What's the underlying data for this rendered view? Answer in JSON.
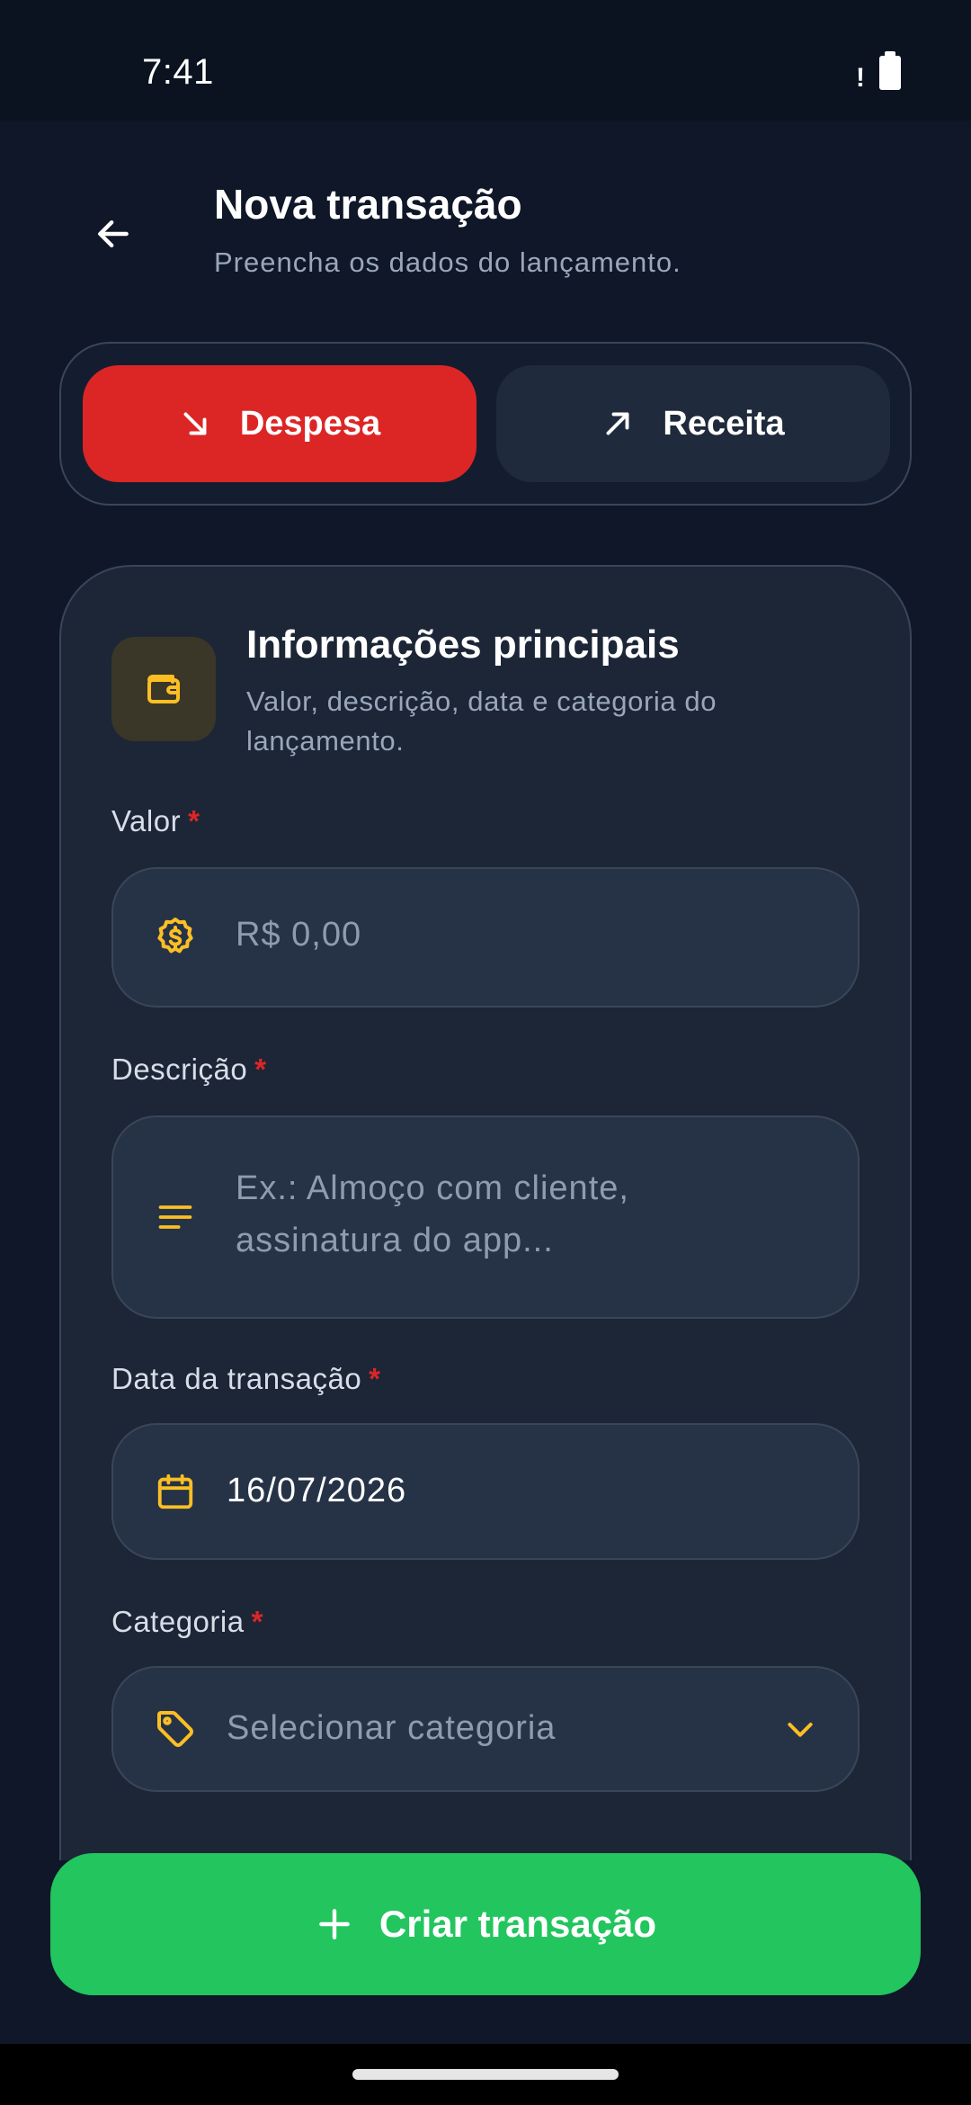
{
  "status_bar": {
    "time": "7:41",
    "alert": "!"
  },
  "header": {
    "title": "Nova transação",
    "subtitle": "Preencha os dados do lançamento."
  },
  "type_toggle": {
    "expense_label": "Despesa",
    "income_label": "Receita",
    "selected": "Despesa"
  },
  "card": {
    "title": "Informações principais",
    "subtitle": "Valor, descrição, data e categoria do lançamento."
  },
  "form": {
    "amount": {
      "label": "Valor",
      "required_mark": "*",
      "placeholder": "R$ 0,00",
      "value": ""
    },
    "description": {
      "label": "Descrição",
      "required_mark": "*",
      "placeholder_line1": "Ex.: Almoço com cliente,",
      "placeholder_line2": "assinatura do app...",
      "value": ""
    },
    "date": {
      "label": "Data da transação",
      "required_mark": "*",
      "value": "16/07/2026"
    },
    "category": {
      "label": "Categoria",
      "required_mark": "*",
      "placeholder": "Selecionar categoria"
    }
  },
  "submit": {
    "label": "Criar transação"
  },
  "icons": {
    "back": "arrow-left-icon",
    "expense": "arrow-down-right-icon",
    "income": "arrow-up-right-icon",
    "card": "wallet-icon",
    "amount": "dollar-badge-icon",
    "description": "text-lines-icon",
    "date": "calendar-icon",
    "category": "tag-icon",
    "dropdown": "chevron-down-icon",
    "submit": "plus-icon"
  },
  "colors": {
    "background": "#0f1729",
    "card": "#1c2637",
    "expense_red": "#dc2626",
    "accent_yellow": "#fbbf24",
    "submit_green": "#22c55e"
  }
}
